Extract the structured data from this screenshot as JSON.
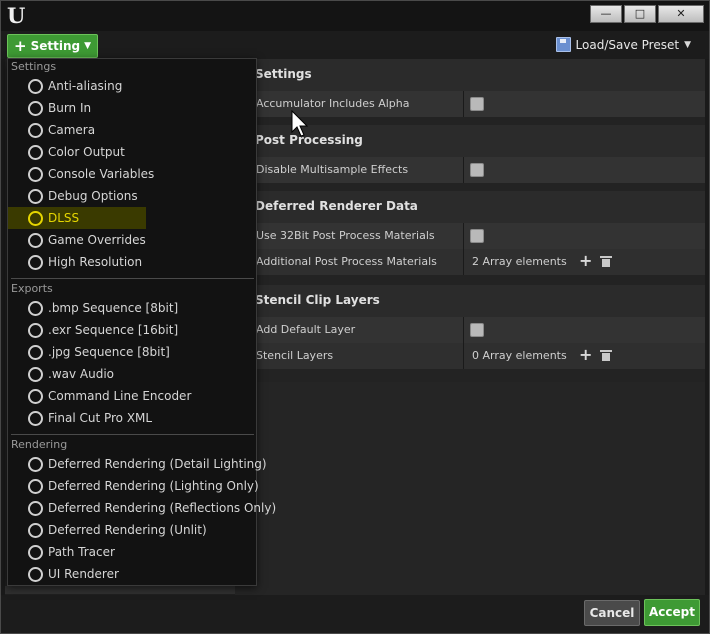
{
  "titlebar": {
    "logo": "U",
    "controls": {
      "minimize": "—",
      "maximize": "□",
      "close": "✕"
    }
  },
  "toolbar": {
    "setting_label": "Setting",
    "preset_label": "Load/Save Preset"
  },
  "settings_panel": {
    "categories": [
      {
        "title": "Settings",
        "rows": [
          {
            "name": "Accumulator Includes Alpha",
            "type": "checkbox"
          }
        ]
      },
      {
        "title": "Post Processing",
        "rows": [
          {
            "name": "Disable Multisample Effects",
            "type": "checkbox"
          }
        ]
      },
      {
        "title": "Deferred Renderer Data",
        "rows": [
          {
            "name": "Use 32Bit Post Process Materials",
            "type": "checkbox"
          },
          {
            "name": "Additional Post Process Materials",
            "type": "array",
            "value": "2 Array elements"
          }
        ]
      },
      {
        "title": "Stencil Clip Layers",
        "rows": [
          {
            "name": "Add Default Layer",
            "type": "checkbox"
          },
          {
            "name": "Stencil Layers",
            "type": "array",
            "value": "0 Array elements"
          }
        ]
      }
    ]
  },
  "dropdown": {
    "groups": [
      {
        "label": "Settings",
        "items": [
          "Anti-aliasing",
          "Burn In",
          "Camera",
          "Color Output",
          "Console Variables",
          "Debug Options",
          "DLSS",
          "Game Overrides",
          "High Resolution"
        ]
      },
      {
        "label": "Exports",
        "items": [
          ".bmp Sequence [8bit]",
          ".exr Sequence [16bit]",
          ".jpg Sequence [8bit]",
          ".wav Audio",
          "Command Line Encoder",
          "Final Cut Pro XML"
        ]
      },
      {
        "label": "Rendering",
        "items": [
          "Deferred Rendering (Detail Lighting)",
          "Deferred Rendering (Lighting Only)",
          "Deferred Rendering (Reflections Only)",
          "Deferred Rendering (Unlit)",
          "Path Tracer",
          "UI Renderer"
        ]
      }
    ],
    "highlighted_item": "DLSS"
  },
  "footer": {
    "cancel_label": "Cancel",
    "accept_label": "Accept"
  },
  "colors": {
    "accent_green": "#3e9a34",
    "highlight_yellow": "#e6d600",
    "background": "#1a1a1a"
  }
}
